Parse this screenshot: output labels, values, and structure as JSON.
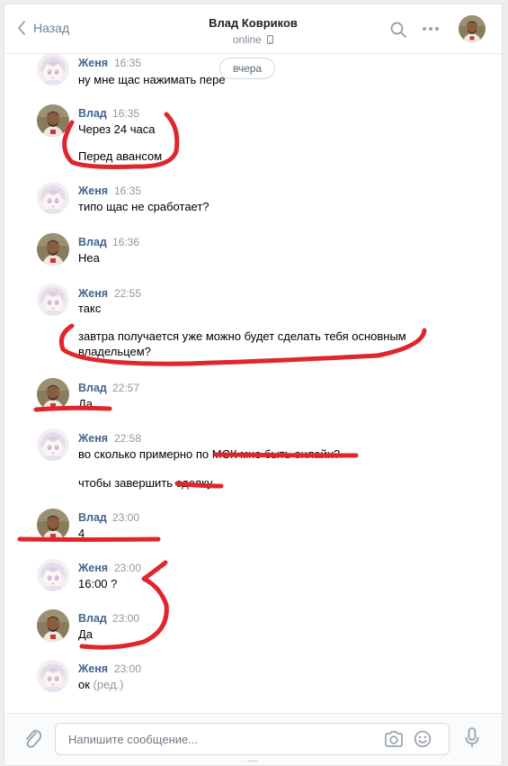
{
  "header": {
    "back_label": "Назад",
    "title": "Влад Ковриков",
    "status": "online"
  },
  "date_separator": "вчера",
  "messages": [
    {
      "author": "Женя",
      "time": "16:35",
      "lines": [
        "ну мне щас нажимать пере"
      ]
    },
    {
      "author": "Влад",
      "time": "16:35",
      "lines": [
        "Через 24 часа",
        "Перед авансом"
      ]
    },
    {
      "author": "Женя",
      "time": "16:35",
      "lines": [
        "типо щас не сработает?"
      ]
    },
    {
      "author": "Влад",
      "time": "16:36",
      "lines": [
        "Неа"
      ]
    },
    {
      "author": "Женя",
      "time": "22:55",
      "lines": [
        "такс",
        "завтра получается уже можно будет сделать тебя основным владельцем?"
      ]
    },
    {
      "author": "Влад",
      "time": "22:57",
      "lines": [
        "Да"
      ]
    },
    {
      "author": "Женя",
      "time": "22:58",
      "lines": [
        "во сколько примерно по МСК мне быть онлайн?",
        "чтобы завершить сделку"
      ]
    },
    {
      "author": "Влад",
      "time": "23:00",
      "lines": [
        "4"
      ]
    },
    {
      "author": "Женя",
      "time": "23:00",
      "lines": [
        "16:00 ?"
      ]
    },
    {
      "author": "Влад",
      "time": "23:00",
      "lines": [
        "Да"
      ]
    },
    {
      "author": "Женя",
      "time": "23:00",
      "lines": [
        "ок"
      ],
      "edited": "(ред.)"
    }
  ],
  "composer": {
    "placeholder": "Напишите сообщение..."
  },
  "icons": {
    "back": "chevron-left-icon",
    "phone": "mobile-phone-icon",
    "search": "search-icon",
    "more": "more-dots-icon",
    "attach": "paperclip-icon",
    "camera": "camera-icon",
    "emoji": "smile-icon",
    "voice": "microphone-icon"
  },
  "colors": {
    "link": "#42648b",
    "annotation": "#e0262c",
    "muted": "#939699"
  }
}
